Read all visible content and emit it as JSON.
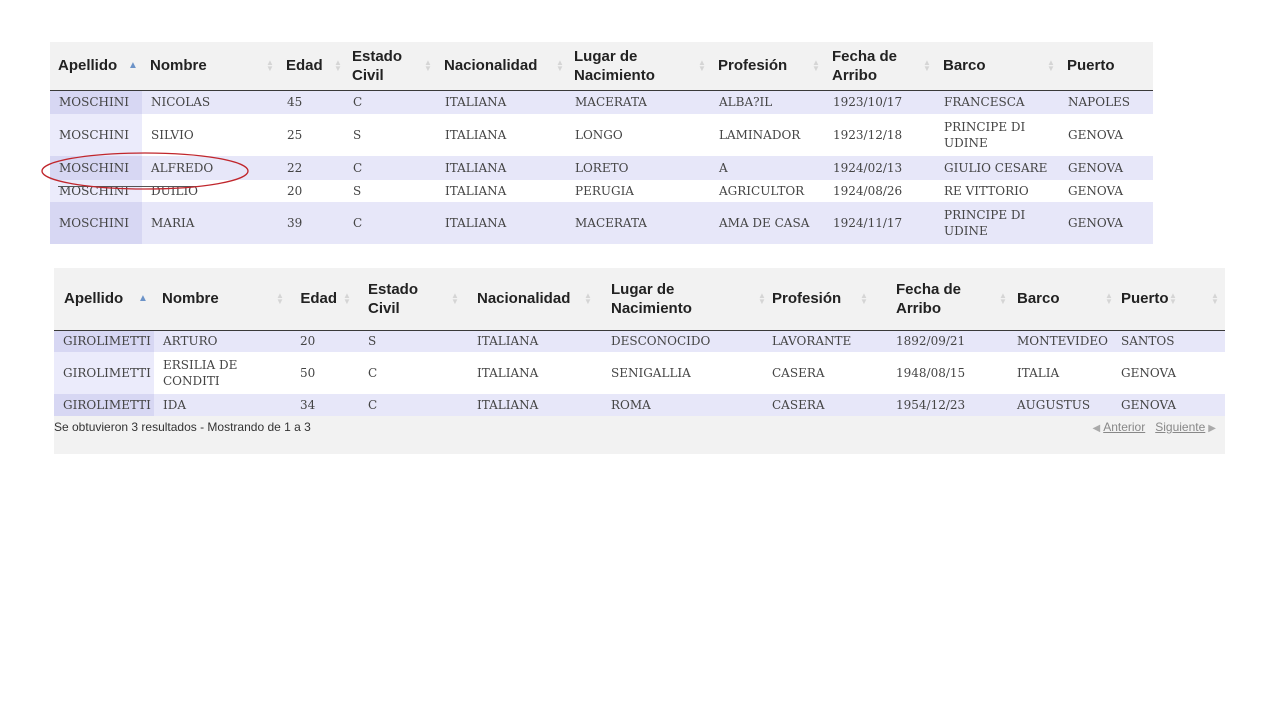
{
  "tables": {
    "moschini": {
      "columns": [
        {
          "label": "Apellido",
          "sort": "asc"
        },
        {
          "label": "Nombre",
          "sort": "both"
        },
        {
          "label": "Edad",
          "sort": "both"
        },
        {
          "label": "Estado Civil",
          "sort": "both"
        },
        {
          "label": "Nacionalidad",
          "sort": "both"
        },
        {
          "label": "Lugar de Nacimiento",
          "sort": "both"
        },
        {
          "label": "Profesión",
          "sort": "both"
        },
        {
          "label": "Fecha de Arribo",
          "sort": "both"
        },
        {
          "label": "Barco",
          "sort": "both"
        },
        {
          "label": "Puerto",
          "sort": "none"
        }
      ],
      "rows": [
        [
          "MOSCHINI",
          "NICOLAS",
          "45",
          "C",
          "ITALIANA",
          "MACERATA",
          "ALBA?IL",
          "1923/10/17",
          "FRANCESCA",
          "NAPOLES"
        ],
        [
          "MOSCHINI",
          "SILVIO",
          "25",
          "S",
          "ITALIANA",
          "LONGO",
          "LAMINADOR",
          "1923/12/18",
          "PRINCIPE DI UDINE",
          "GENOVA"
        ],
        [
          "MOSCHINI",
          "ALFREDO",
          "22",
          "C",
          "ITALIANA",
          "LORETO",
          "A",
          "1924/02/13",
          "GIULIO CESARE",
          "GENOVA"
        ],
        [
          "MOSCHINI",
          "DUILIO",
          "20",
          "S",
          "ITALIANA",
          "PERUGIA",
          "AGRICULTOR",
          "1924/08/26",
          "RE VITTORIO",
          "GENOVA"
        ],
        [
          "MOSCHINI",
          "MARIA",
          "39",
          "C",
          "ITALIANA",
          "MACERATA",
          "AMA DE CASA",
          "1924/11/17",
          "PRINCIPE DI UDINE",
          "GENOVA"
        ]
      ]
    },
    "girolimetti": {
      "columns": [
        {
          "label": "Apellido",
          "sort": "asc"
        },
        {
          "label": "Nombre",
          "sort": "both"
        },
        {
          "label": "Edad",
          "sort": "both"
        },
        {
          "label": "Estado Civil",
          "sort": "both"
        },
        {
          "label": "Nacionalidad",
          "sort": "both"
        },
        {
          "label": "Lugar de Nacimiento",
          "sort": "both"
        },
        {
          "label": "Profesión",
          "sort": "both"
        },
        {
          "label": "Fecha de Arribo",
          "sort": "both"
        },
        {
          "label": "Barco",
          "sort": "both"
        },
        {
          "label": "Puerto",
          "sort": "both"
        },
        {
          "label": "",
          "sort": "both"
        }
      ],
      "rows": [
        [
          "GIROLIMETTI",
          "ARTURO",
          "20",
          "S",
          "ITALIANA",
          "DESCONOCIDO",
          "LAVORANTE",
          "1892/09/21",
          "MONTEVIDEO",
          "SANTOS",
          ""
        ],
        [
          "GIROLIMETTI",
          "ERSILIA DE CONDITI",
          "50",
          "C",
          "ITALIANA",
          "SENIGALLIA",
          "CASERA",
          "1948/08/15",
          "ITALIA",
          "GENOVA",
          ""
        ],
        [
          "GIROLIMETTI",
          "IDA",
          "34",
          "C",
          "ITALIANA",
          "ROMA",
          "CASERA",
          "1954/12/23",
          "AUGUSTUS",
          "GENOVA",
          ""
        ]
      ],
      "info": "Se obtuvieron 3 resultados - Mostrando de 1 a 3",
      "pager": {
        "previous": "Anterior",
        "next": "Siguiente"
      }
    }
  },
  "annotation": {
    "color": "#c0262c"
  },
  "colors": {
    "odd_row": "#e7e7f9",
    "sorted_odd": "#d7d7f3",
    "header_bg": "#f2f2f2",
    "sort_active": "#6c93c8"
  }
}
